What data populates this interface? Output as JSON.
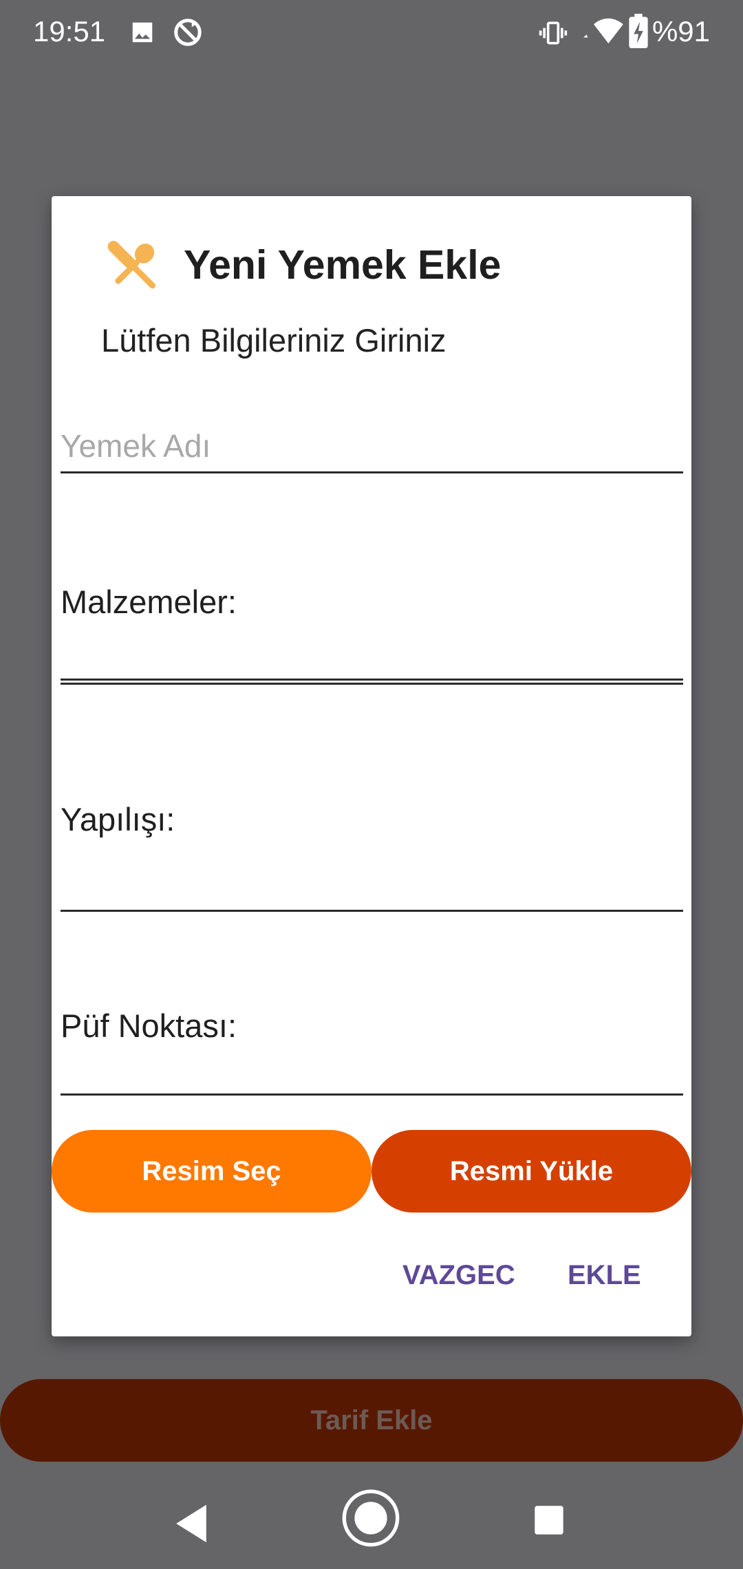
{
  "status_bar": {
    "time": "19:51",
    "battery_text": "%91",
    "icons": [
      "image-icon",
      "sync-disabled-icon",
      "vibrate-icon",
      "wifi-icon",
      "battery-charging-icon"
    ]
  },
  "dialog": {
    "title": "Yeni Yemek Ekle",
    "subtitle": "Lütfen Bilgileriniz Giriniz",
    "title_icon": "fork-spoon-icon",
    "name_field": {
      "placeholder": "Yemek Adı",
      "value": ""
    },
    "ingredients_label": "Malzemeler:",
    "preparation_label": "Yapılışı:",
    "tips_label": "Püf Noktası:",
    "select_image_button": "Resim Seç",
    "upload_image_button": "Resmi Yükle",
    "cancel_button": "VAZGEC",
    "add_button": "EKLE"
  },
  "background": {
    "add_recipe_button": "Tarif Ekle"
  },
  "navigation": {
    "back": "back-icon",
    "home": "home-icon",
    "recents": "recents-icon"
  },
  "colors": {
    "scrim": "#656467",
    "select_button": "#ff7800",
    "upload_button": "#d54000",
    "text_button": "#5e4898",
    "icon_accent": "#f5b352",
    "background_button": "#571802"
  }
}
